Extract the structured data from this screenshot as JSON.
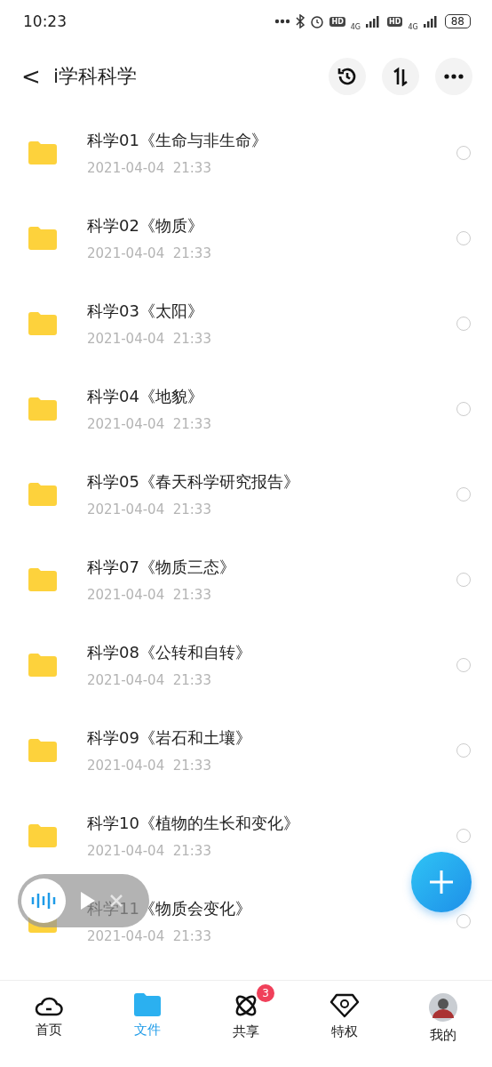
{
  "status_bar": {
    "time": "10:23",
    "hd_1": "HD",
    "network_1": "4G",
    "hd_2": "HD",
    "network_2": "4G",
    "battery": "88"
  },
  "header": {
    "back": "<",
    "title": "i学科科学"
  },
  "files": [
    {
      "name": "科学01《生命与非生命》",
      "date": "2021-04-04  21:33",
      "selected": false
    },
    {
      "name": "科学02《物质》",
      "date": "2021-04-04  21:33",
      "selected": false
    },
    {
      "name": "科学03《太阳》",
      "date": "2021-04-04  21:33",
      "selected": false
    },
    {
      "name": "科学04《地貌》",
      "date": "2021-04-04  21:33",
      "selected": false
    },
    {
      "name": "科学05《春天科学研究报告》",
      "date": "2021-04-04  21:33",
      "selected": false
    },
    {
      "name": "科学07《物质三态》",
      "date": "2021-04-04  21:33",
      "selected": false
    },
    {
      "name": "科学08《公转和自转》",
      "date": "2021-04-04  21:33",
      "selected": false
    },
    {
      "name": "科学09《岩石和土壤》",
      "date": "2021-04-04  21:33",
      "selected": false
    },
    {
      "name": "科学10《植物的生长和变化》",
      "date": "2021-04-04  21:33",
      "selected": false
    },
    {
      "name": "科学11《物质会变化》",
      "date": "2021-04-04  21:33",
      "selected": false
    }
  ],
  "nav": [
    {
      "kind": "cloud",
      "label": "首页",
      "selected": false
    },
    {
      "kind": "folder",
      "label": "文件",
      "selected": true
    },
    {
      "kind": "atom",
      "label": "共享",
      "selected": false,
      "badge": "3"
    },
    {
      "kind": "diamond",
      "label": "特权",
      "selected": false
    },
    {
      "kind": "avatar",
      "label": "我的",
      "selected": false
    }
  ]
}
